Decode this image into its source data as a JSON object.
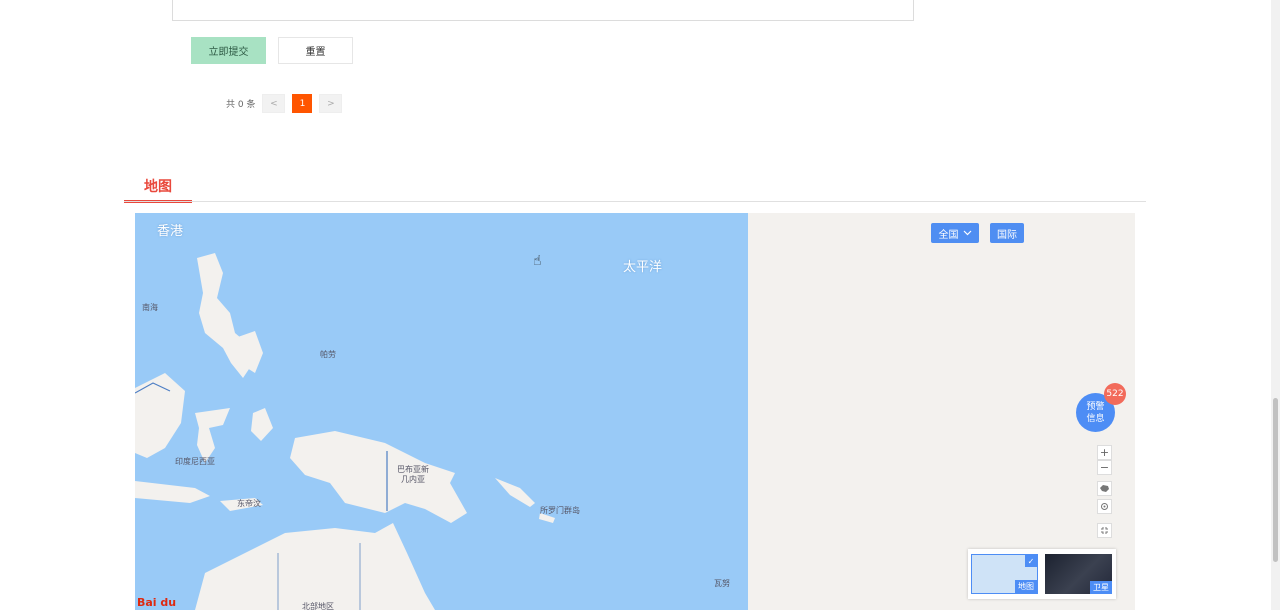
{
  "form": {
    "submit_label": "立即提交",
    "reset_label": "重置"
  },
  "pagination": {
    "total_text": "共 0 条",
    "prev": "<",
    "current_page": "1",
    "next": ">"
  },
  "section": {
    "title": "地图"
  },
  "map": {
    "labels": {
      "hongkong": "香港",
      "pacific": "太平洋",
      "nansha": "南海",
      "palau": "帕劳",
      "indonesia": "印度尼西亚",
      "png": "巴布亚新\n几内亚",
      "solomon": "所罗门群岛",
      "timor": "东帝汶",
      "northern_territory": "北部地区",
      "vanuatu": "瓦努"
    },
    "region_button": "全国",
    "intl_button": "国际",
    "alert": {
      "label": "预警\n信息",
      "count": "522"
    },
    "controls": {
      "zoom_in": "+",
      "zoom_out": "−"
    },
    "map_type": {
      "map_label": "地图",
      "satellite_label": "卫星"
    },
    "logo": "Bai du",
    "colors": {
      "ocean": "#99caf7",
      "land": "#f3f1ee",
      "accent": "#4d8df5",
      "badge": "#f26b5b"
    }
  }
}
